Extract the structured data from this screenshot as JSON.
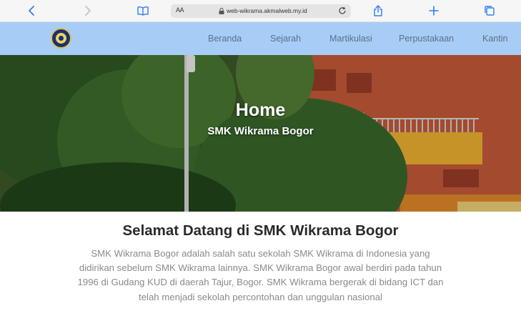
{
  "browser": {
    "aa_label": "AA",
    "url": "web-wikrama.akmalweb.my.id",
    "icons": [
      "back-icon",
      "forward-icon",
      "book-icon",
      "lock-icon",
      "reload-icon",
      "share-icon",
      "plus-icon",
      "tabs-icon"
    ]
  },
  "nav": {
    "items": [
      "Beranda",
      "Sejarah",
      "Martikulasi",
      "Perpustakaan",
      "Kantin"
    ]
  },
  "hero": {
    "title": "Home",
    "subtitle": "SMK Wikrama Bogor"
  },
  "welcome": {
    "title": "Selamat Datang di SMK Wikrama Bogor",
    "text": "SMK Wikrama Bogor adalah salah satu sekolah SMK Wikrama di Indonesia yang didirikan sebelum SMK Wikrama lainnya. SMK Wikrama Bogor awal berdiri pada tahun 1996 di Gudang KUD di daerah Tajur, Bogor. SMK Wikrama bergerak di bidang ICT dan telah menjadi sekolah percontohan dan unggulan nasional"
  },
  "colors": {
    "nav_bg": "#a7cdf7",
    "nav_text": "#5c6f86",
    "safari_accent": "#2f7cf6"
  }
}
